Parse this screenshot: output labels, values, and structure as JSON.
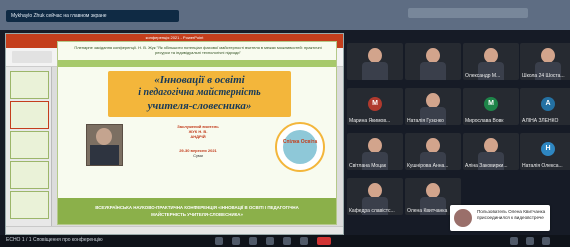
{
  "share_banner": "Mykhaylo Zhuk сейчас на главном экране",
  "ppt": {
    "window_title": "конференція 2021 - PowerPoint",
    "slide": {
      "header": "Пленарне засідання конференції. Н. В. Жук \"Як збільшити потенціал фахової майстерності вчителя в межах можливостей: практичні ресурси та індивідуальні технологічні підходи\"",
      "main_title_lines": [
        "«Інновації в освіті",
        "і педагогічна майстерність",
        "учителя-словесника»"
      ],
      "speaker_lines": [
        "Заслужений вчитель",
        "ЖУК Н. В.",
        "АНДРІЙ"
      ],
      "date": "29-30 вересня 2021",
      "city": "Суми",
      "emblem": "Спілка Освіта",
      "footer_lines": [
        "ВСЕУКРАЇНСЬКА НАУКОВО-ПРАКТИЧНА КОНФЕРЕНЦІЯ «ІННОВАЦІЇ В ОСВІТІ І ПЕДАГОГІЧНА",
        "МАЙСТЕРНІСТЬ УЧИТЕЛЯ-СЛОВЕСНИКА»"
      ]
    }
  },
  "participants": [
    {
      "name": "",
      "type": "cam"
    },
    {
      "name": "",
      "type": "cam"
    },
    {
      "name": "Олександр М...",
      "type": "cam"
    },
    {
      "name": "Школа 24 Шоста...",
      "type": "cam"
    },
    {
      "name": "Марина Якимов...",
      "type": "avatar",
      "initial": "M",
      "color": "#b03a2e"
    },
    {
      "name": "Наталія Гузєнко",
      "type": "cam"
    },
    {
      "name": "Мирослава Вовк",
      "type": "avatar",
      "initial": "M",
      "color": "#1e8449"
    },
    {
      "name": "АЛІНА ЗЛЕНКО",
      "type": "avatar",
      "initial": "A",
      "color": "#2471a3"
    },
    {
      "name": "Світлана Моцак",
      "type": "cam"
    },
    {
      "name": "Кушнірова Анна...",
      "type": "cam"
    },
    {
      "name": "Аліна Заковирки...",
      "type": "cam"
    },
    {
      "name": "Наталія Олекса...",
      "type": "avatar",
      "initial": "H",
      "color": "#2e86c1"
    },
    {
      "name": "Кафедра славістс...",
      "type": "cam"
    },
    {
      "name": "Олена Квитчанка",
      "type": "cam"
    }
  ],
  "toast": "Пользователь Олена Квитчанка присоединился к видеовстрече",
  "bottom_left": "ECHO 1 / 1  Сповіщення про конференцію"
}
